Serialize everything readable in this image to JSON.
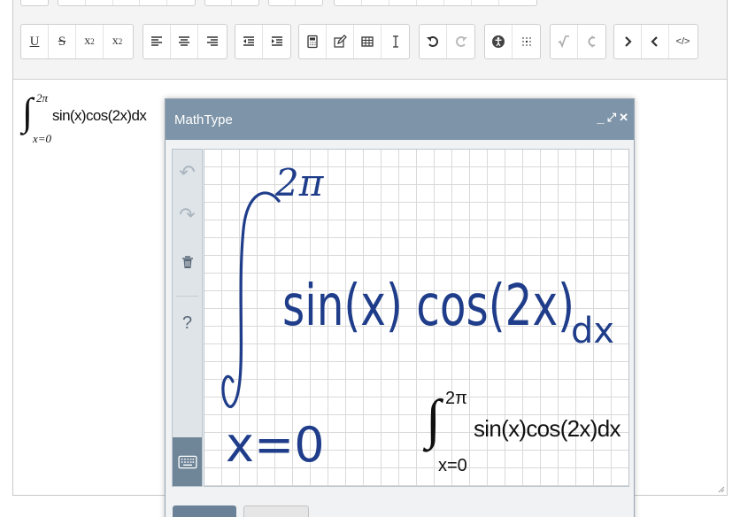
{
  "editor": {
    "formula": {
      "upper": "2π",
      "lower": "x=0",
      "body": "sin(x)cos(2x)dx"
    },
    "toolbar_row2": {
      "underline": "U",
      "strikethrough": "S",
      "subscript_base": "x",
      "subscript_exp": "2",
      "superscript_base": "x",
      "superscript_exp": "2",
      "source_code": "</>"
    }
  },
  "mathtype": {
    "title": "MathType",
    "controls": {
      "minimize": "_",
      "maximize": "⤢",
      "close": "✕"
    },
    "sidebar": {
      "undo": "↶",
      "redo": "↷",
      "help": "?"
    },
    "handwriting": {
      "upper": "2π",
      "body_text": "sin(x) cos(2x)",
      "dx": "dx",
      "lower": "x=0"
    },
    "preview": {
      "upper": "2π",
      "lower": "x=0",
      "body": "sin(x)cos(2x)dx"
    }
  },
  "colors": {
    "toolbar_bg": "#f4f4f4",
    "dialog_title_bg": "#7e94a8",
    "ink": "#1f3d8a",
    "primary_button": "#6b8197"
  }
}
